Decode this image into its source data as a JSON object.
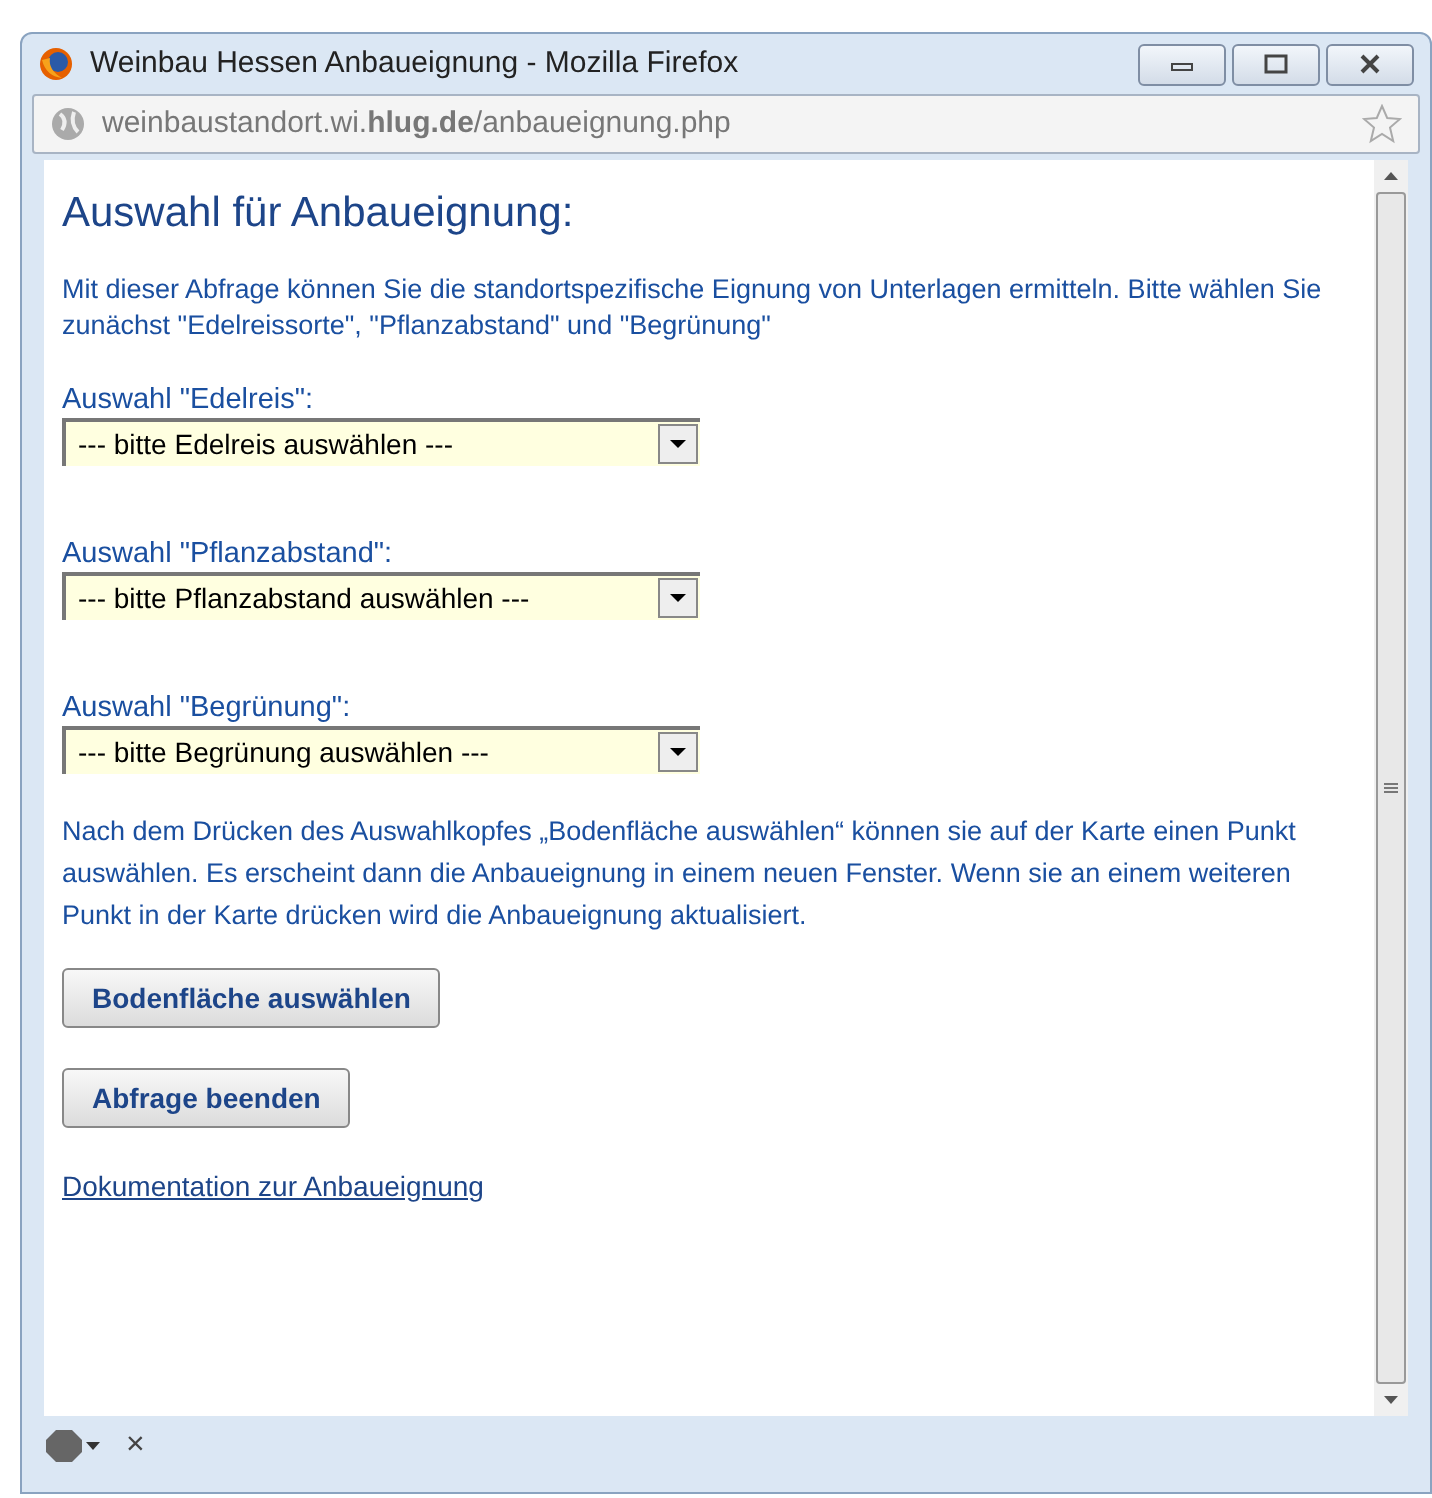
{
  "window": {
    "title": "Weinbau Hessen Anbaueignung - Mozilla Firefox"
  },
  "address_bar": {
    "url": "weinbaustandort.wi.**hlug.de**/anbaueignung.php"
  },
  "page": {
    "heading": "Auswahl für Anbaueignung:",
    "intro": "Mit dieser Abfrage können Sie die standortspezifische Eignung von Unterlagen ermitteln. Bitte wählen Sie zunächst \"Edelreissorte\", \"Pflanzabstand\" und \"Begrünung\"",
    "selects": [
      {
        "label": "Auswahl \"Edelreis\":",
        "value": "--- bitte Edelreis auswählen ---"
      },
      {
        "label": "Auswahl \"Pflanzabstand\":",
        "value": "--- bitte Pflanzabstand auswählen ---"
      },
      {
        "label": "Auswahl \"Begrünung\":",
        "value": "--- bitte Begrünung auswählen ---"
      }
    ],
    "note": "Nach dem Drücken des Auswahlkopfes „Bodenfläche auswählen“ können sie auf der Karte einen Punkt auswählen. Es erscheint dann die Anbaueignung in einem neuen Fenster. Wenn sie an einem weiteren Punkt in der Karte drücken wird die Anbaueignung aktualisiert.",
    "buttons": [
      "Bodenfläche auswählen",
      "Abfrage beenden"
    ],
    "link": "Dokumentation zur Anbaueignung"
  },
  "addon_bar": {
    "close": "×"
  }
}
